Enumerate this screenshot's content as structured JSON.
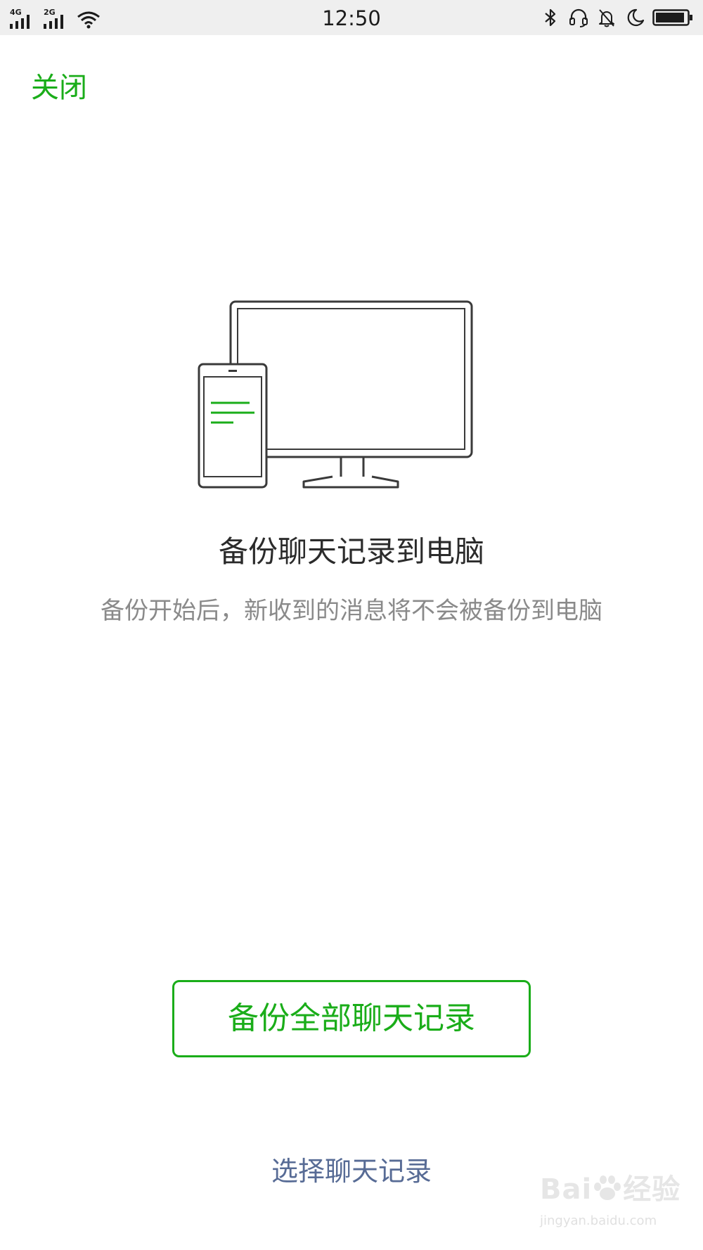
{
  "status_bar": {
    "net1": "4G",
    "net2": "2G",
    "time": "12:50",
    "icons": [
      "bluetooth-icon",
      "headset-icon",
      "alarm-off-icon",
      "moon-icon",
      "battery-icon"
    ]
  },
  "header": {
    "close_label": "关闭"
  },
  "main": {
    "illustration": "phone-and-monitor-icon",
    "title": "备份聊天记录到电脑",
    "subtitle": "备份开始后，新收到的消息将不会被备份到电脑",
    "backup_all_label": "备份全部聊天记录",
    "select_label": "选择聊天记录"
  },
  "watermark": {
    "brand": "Bai",
    "brand_suffix": "经验",
    "url": "jingyan.baidu.com"
  },
  "colors": {
    "accent": "#1aad19",
    "link": "#576b95",
    "title": "#2b2b2b",
    "subtitle": "#8a8a8a",
    "status_bar_bg": "#efefef"
  }
}
